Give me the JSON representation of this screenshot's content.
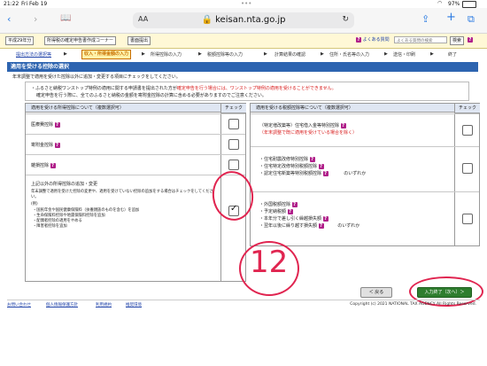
{
  "status": {
    "time": "21:22",
    "date": "Fri Feb 19",
    "battery": "97%"
  },
  "browser": {
    "aa": "AA",
    "url": "keisan.nta.go.jp"
  },
  "header": {
    "year_btn": "平成29年分",
    "corner_btn": "所得税の確定申告書作成コーナー",
    "save_btn": "書面提出",
    "faq": "よくある質問",
    "search_placeholder": "よくある質問の検索",
    "search_btn": "検索",
    "help": "ヘルプ"
  },
  "steps": [
    "提出方法の選択等",
    "収入・所得金額の入力",
    "所得控除の入力",
    "税額控除等の入力",
    "計算結果の確認",
    "住所・氏名等の入力",
    "送信・印刷",
    "終了"
  ],
  "title": "適用を受ける控除の選択",
  "intro": "年末調整で適用を受けた控除以外に追加・変更する項目にチェックをしてください。",
  "note": {
    "line1_a": "ふるさと納税ワンストップ特例の適用に関する申請書を提出された方が",
    "line1_b": "確定申告を行う場合には、ワンストップ特例の適用を受けることができません。",
    "line2": "確定申告を行う際に、全てのふるさと納税の金額を寄附金控除の計算に含める必要がありますのでご注意ください。"
  },
  "left_panel": {
    "header": "適用を受ける所得控除について（複数選択可）",
    "check_header": "チェック",
    "rows": [
      {
        "label": "医療費控除",
        "checked": false
      },
      {
        "label": "寄附金控除",
        "checked": false
      },
      {
        "label": "雑損控除",
        "checked": false
      }
    ],
    "other": {
      "title": "上記以外の所得控除の追加・変更",
      "desc": "年末調整で適用を受けた控除の変更や、適用を受けていない控除の追加をする場合はチェックをしてください。",
      "example_label": "(例)",
      "examples": [
        "国民年金や国民健康保険料（扶養親族のものを含む）を追加",
        "生命保険料控除や地震保険料控除を追加",
        "配偶者控除の適用をやめる",
        "障害者控除を追加"
      ],
      "checked": true
    }
  },
  "right_panel": {
    "header": "適用を受ける税額控除等について（複数選択可）",
    "check_header": "チェック",
    "row1": {
      "label": "（特定増改築等）住宅借入金等特別控除",
      "sub": "（年末調整で既に適用を受けている場合を除く）",
      "checked": false
    },
    "row2": {
      "items": [
        "住宅耐震改修特別控除",
        "住宅特定改修特別税額控除",
        "認定住宅新築等特別税額控除"
      ],
      "suffix": "のいずれか",
      "checked": false
    },
    "row3": {
      "items": [
        "外国税額控除",
        "予定納税額",
        "本年分で差し引く繰越損失額",
        "翌年以後に繰り越す損失額"
      ],
      "suffix": "のいずれか",
      "checked": false
    }
  },
  "buttons": {
    "back": "＜ 戻る",
    "next": "入力終了（次へ）＞"
  },
  "footer": {
    "links": [
      "お問い合わせ",
      "個人情報保護方針",
      "利用規約",
      "推奨環境"
    ],
    "copyright": "Copyright (c) 2021 NATIONAL TAX AGENCY All Rights Reserved."
  },
  "annotation": {
    "handwritten": "12"
  },
  "colors": {
    "title_bg": "#2d64b0",
    "header_bg": "#fff8d6",
    "next_btn": "#2e7d2e",
    "note_red": "#d81b1b",
    "annotation": "#e02550"
  }
}
